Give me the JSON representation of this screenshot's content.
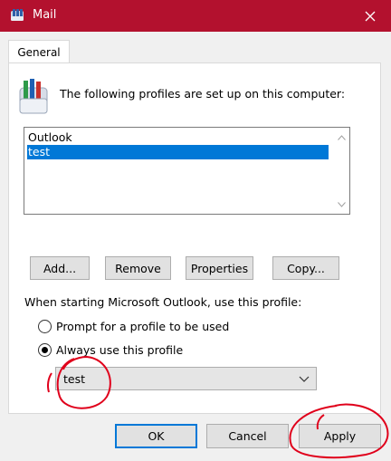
{
  "window": {
    "title": "Mail"
  },
  "tabs": [
    {
      "label": "General"
    }
  ],
  "heading": "The following profiles are set up on this computer:",
  "profiles": [
    {
      "name": "Outlook",
      "selected": false
    },
    {
      "name": "test",
      "selected": true
    }
  ],
  "buttons": {
    "add": "Add...",
    "remove": "Remove",
    "properties": "Properties",
    "copy": "Copy..."
  },
  "startup": {
    "label": "When starting Microsoft Outlook, use this profile:",
    "option_prompt": "Prompt for a profile to be used",
    "option_always": "Always use this profile",
    "selected_option": "always",
    "profile_value": "test"
  },
  "footer": {
    "ok": "OK",
    "cancel": "Cancel",
    "apply": "Apply"
  },
  "colors": {
    "titlebar": "#b3112e",
    "selection": "#0078d7",
    "annotation": "#e0001b"
  }
}
